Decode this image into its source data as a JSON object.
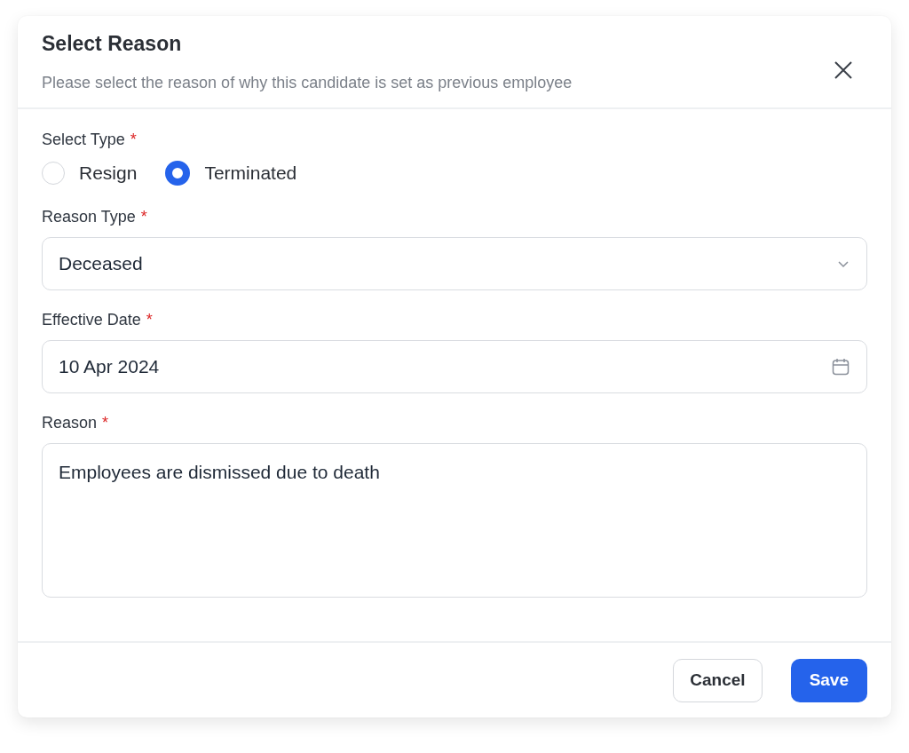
{
  "dialog": {
    "title": "Select Reason",
    "subtitle": "Please select the reason of why this candidate is set as previous employee"
  },
  "fields": [
    {
      "kind": "radio",
      "label": "Select Type",
      "required_mark": "*",
      "options": [
        {
          "label": "Resign",
          "selected": false
        },
        {
          "label": "Terminated",
          "selected": true
        }
      ]
    },
    {
      "kind": "select",
      "label": "Reason Type",
      "required_mark": "*",
      "value": "Deceased"
    },
    {
      "kind": "date",
      "label": "Effective Date",
      "required_mark": "*",
      "value": "10 Apr 2024"
    },
    {
      "kind": "textarea",
      "label": "Reason",
      "required_mark": "*",
      "value": "Employees are dismissed due to death"
    }
  ],
  "buttons": [
    {
      "label": "Cancel",
      "kind": "secondary"
    },
    {
      "label": "Save",
      "kind": "primary"
    }
  ]
}
